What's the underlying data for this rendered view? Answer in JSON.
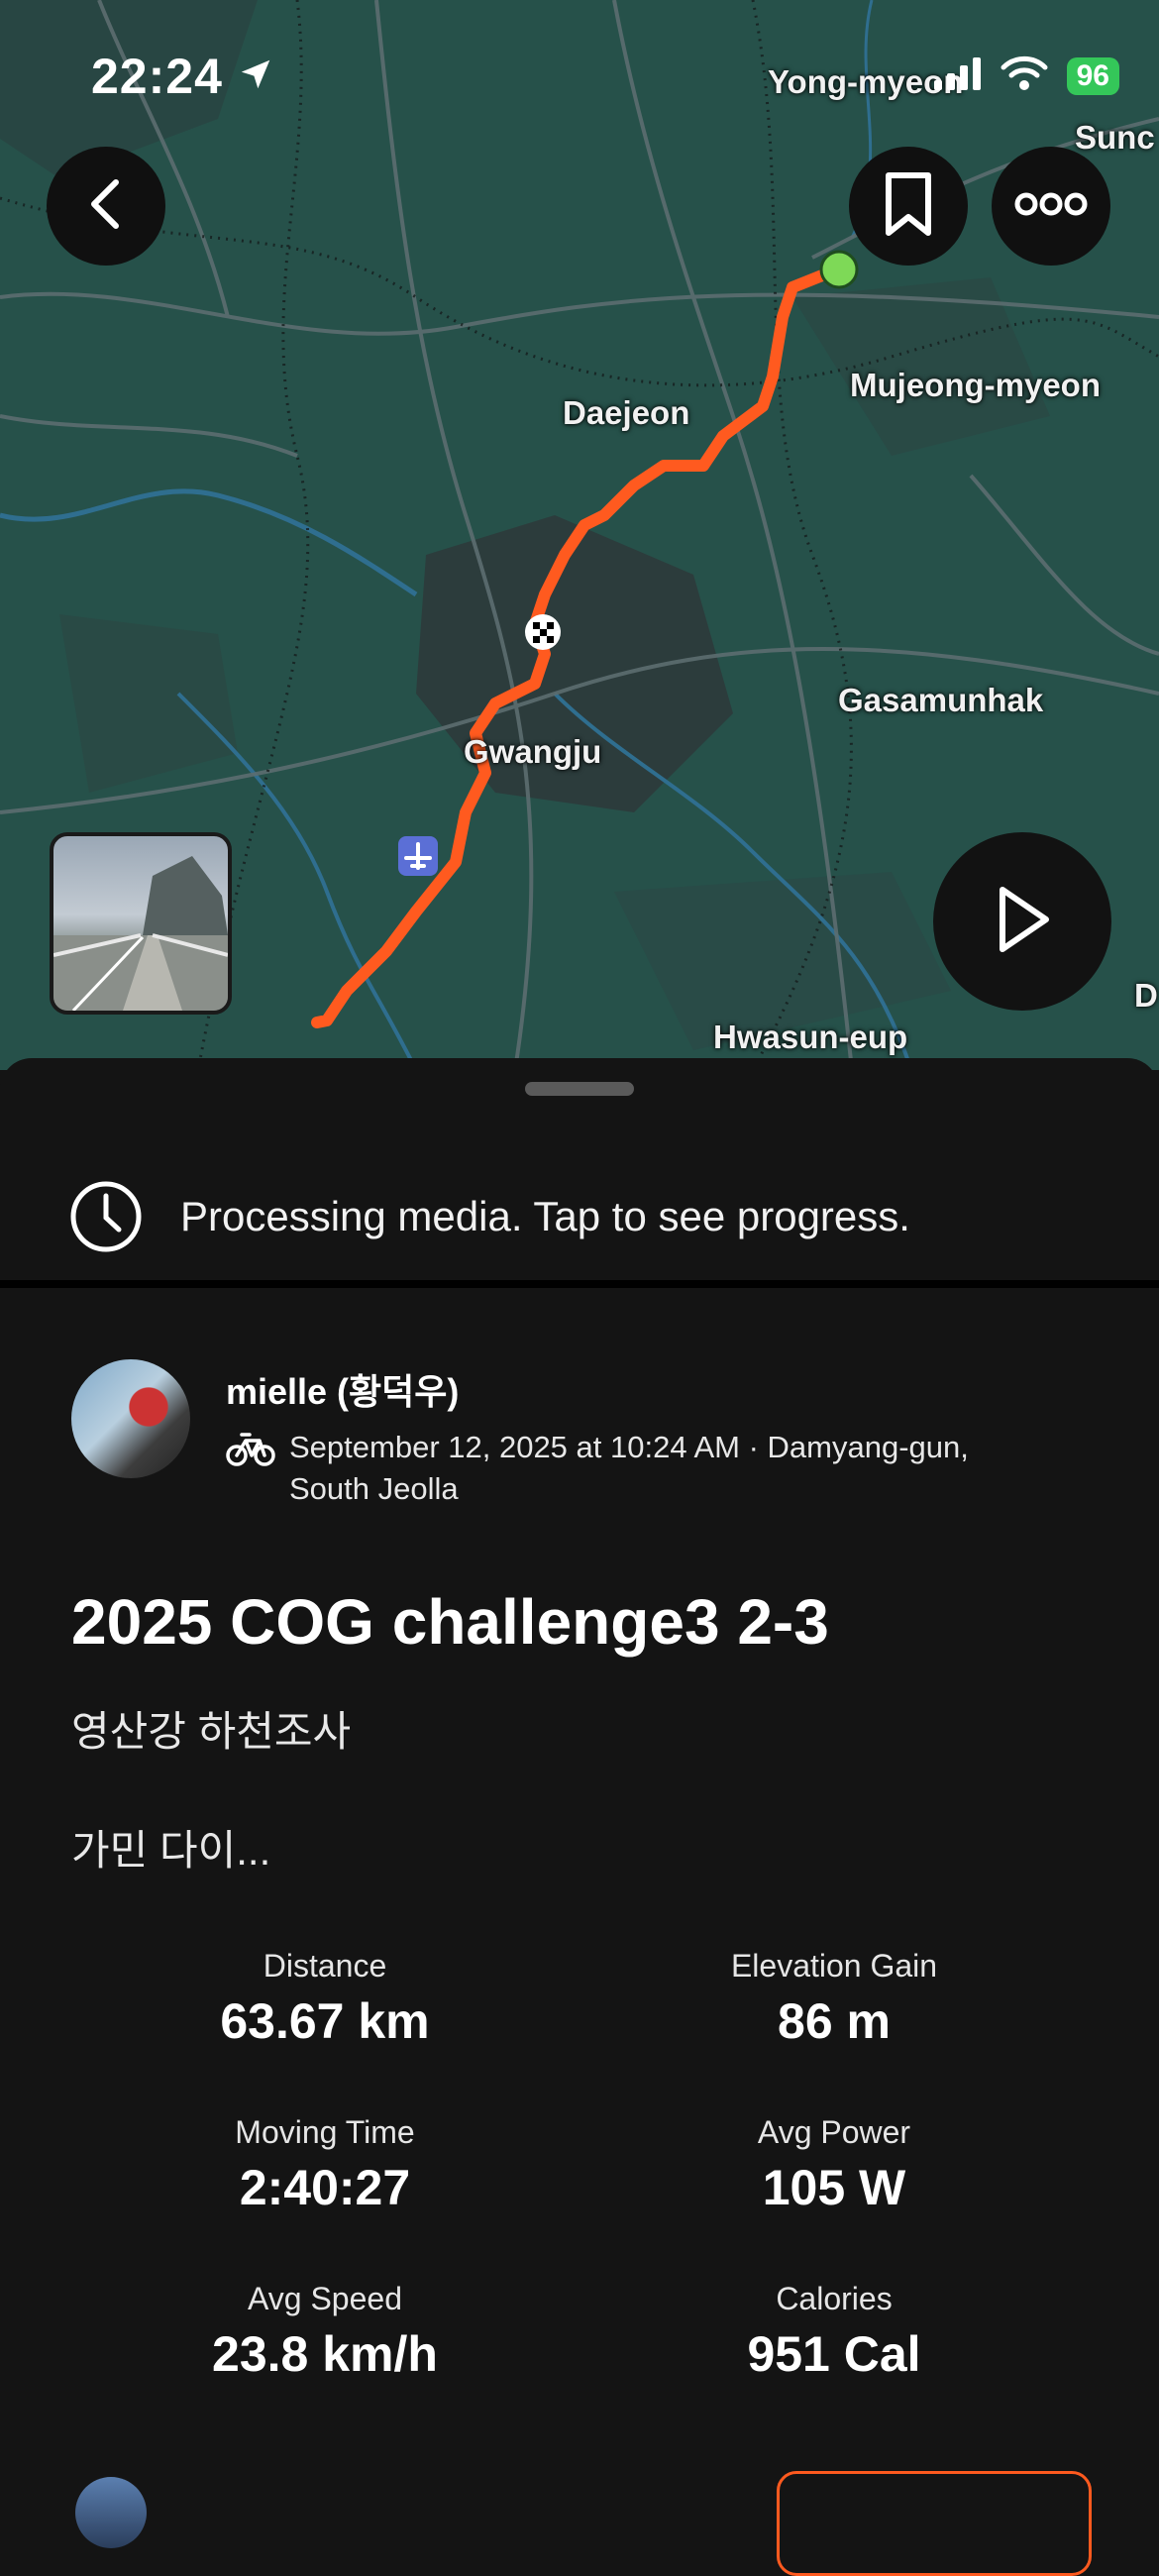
{
  "status_bar": {
    "time": "22:24",
    "battery": "96"
  },
  "map": {
    "labels": {
      "yong_myeon": "Yong-myeon",
      "sunc": "Sunc",
      "daejeon": "Daejeon",
      "mujeong": "Mujeong-myeon",
      "gasamunhak": "Gasamunhak",
      "gwangju": "Gwangju",
      "hwasun": "Hwasun-eup",
      "d": "D"
    },
    "route_color": "#ff5a1f",
    "start_color": "#7ed957"
  },
  "processing": {
    "text": "Processing media. Tap to see progress."
  },
  "activity": {
    "athlete": "mielle (황덕우)",
    "date_location": "September 12, 2025 at 10:24 AM · Damyang-gun, South Jeolla",
    "title": "2025 COG challenge3 2-3",
    "description_line1": "영산강 하천조사",
    "description_line2": "가민 다이..."
  },
  "stats": {
    "distance": {
      "label": "Distance",
      "value": "63.67 km"
    },
    "elevation": {
      "label": "Elevation Gain",
      "value": "86 m"
    },
    "moving_time": {
      "label": "Moving Time",
      "value": "2:40:27"
    },
    "avg_power": {
      "label": "Avg Power",
      "value": "105 W"
    },
    "avg_speed": {
      "label": "Avg Speed",
      "value": "23.8 km/h"
    },
    "calories": {
      "label": "Calories",
      "value": "951 Cal"
    }
  }
}
